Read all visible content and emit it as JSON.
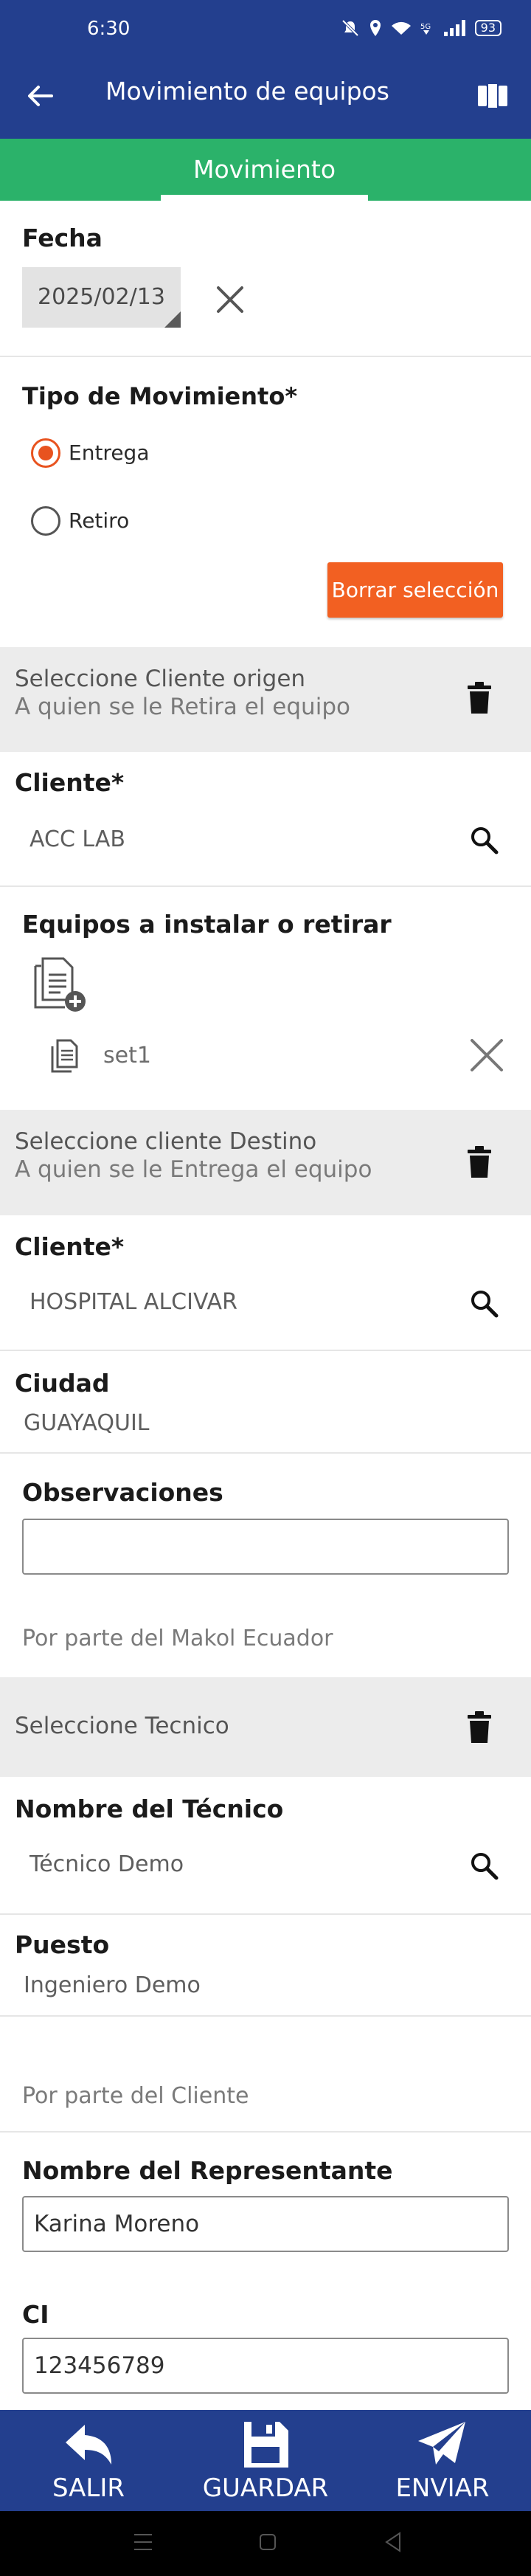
{
  "status_bar": {
    "time": "6:30",
    "battery": "93"
  },
  "app_bar": {
    "title": "Movimiento de equipos"
  },
  "tabs": [
    {
      "label": "Movimiento"
    }
  ],
  "fecha": {
    "label": "Fecha",
    "value": "2025/02/13"
  },
  "tipo_movimiento": {
    "label": "Tipo de Movimiento*",
    "options": [
      {
        "label": "Entrega",
        "selected": true
      },
      {
        "label": "Retiro",
        "selected": false
      }
    ],
    "clear_button": "Borrar selección"
  },
  "cliente_origen": {
    "title": "Seleccione Cliente origen",
    "subtitle": "A quien se le Retira el equipo",
    "cliente_label": "Cliente*",
    "cliente_value": "ACC LAB"
  },
  "equipos": {
    "label": "Equipos a instalar o retirar",
    "items": [
      {
        "name": "set1"
      }
    ]
  },
  "cliente_destino": {
    "title": "Seleccione cliente Destino",
    "subtitle": "A quien se le Entrega el equipo",
    "cliente_label": "Cliente*",
    "cliente_value": "HOSPITAL ALCIVAR",
    "ciudad_label": "Ciudad",
    "ciudad_value": "GUAYAQUIL"
  },
  "observaciones": {
    "label": "Observaciones",
    "value": ""
  },
  "makol": {
    "note": "Por parte del Makol Ecuador",
    "tecnico_band": "Seleccione Tecnico",
    "nombre_label": "Nombre del Técnico",
    "nombre_value": "Técnico Demo",
    "puesto_label": "Puesto",
    "puesto_value": "Ingeniero Demo"
  },
  "cliente_parte": {
    "note": "Por parte del Cliente",
    "representante_label": "Nombre del Representante",
    "representante_value": "Karina Moreno",
    "ci_label": "CI",
    "ci_value": "123456789"
  },
  "bottom_bar": {
    "salir": "SALIR",
    "guardar": "GUARDAR",
    "enviar": "ENVIAR"
  },
  "colors": {
    "primary": "#233f8e",
    "tab_green": "#2bb26a",
    "accent": "#f26022",
    "radio": "#e8531f"
  }
}
